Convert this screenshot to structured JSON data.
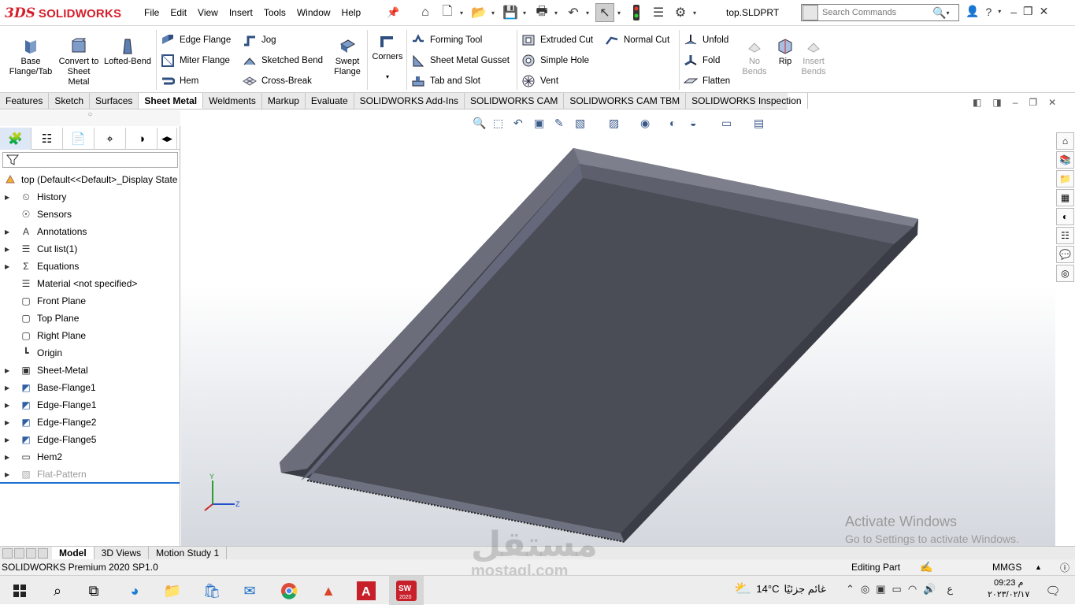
{
  "app": {
    "brand_prefix": "3DS",
    "brand": "SOLIDWORKS",
    "document_title": "top.SLDPRT"
  },
  "menu": [
    "File",
    "Edit",
    "View",
    "Insert",
    "Tools",
    "Window",
    "Help"
  ],
  "search": {
    "placeholder": "Search Commands"
  },
  "ribbon": {
    "base_flange": "Base Flange/Tab",
    "convert": "Convert to Sheet Metal",
    "lofted_bend": "Lofted-Bend",
    "edge_flange": "Edge Flange",
    "miter_flange": "Miter Flange",
    "hem": "Hem",
    "jog": "Jog",
    "sketched_bend": "Sketched Bend",
    "cross_break": "Cross-Break",
    "swept_flange": "Swept Flange",
    "corners": "Corners",
    "forming_tool": "Forming Tool",
    "sheet_metal_gusset": "Sheet Metal Gusset",
    "tab_and_slot": "Tab and Slot",
    "extruded_cut": "Extruded Cut",
    "simple_hole": "Simple Hole",
    "vent": "Vent",
    "normal_cut": "Normal Cut",
    "unfold": "Unfold",
    "fold": "Fold",
    "flatten": "Flatten",
    "no_bends": "No Bends",
    "rip": "Rip",
    "insert_bends": "Insert Bends"
  },
  "command_tabs": [
    "Features",
    "Sketch",
    "Surfaces",
    "Sheet Metal",
    "Weldments",
    "Markup",
    "Evaluate",
    "SOLIDWORKS Add-Ins",
    "SOLIDWORKS CAM",
    "SOLIDWORKS CAM TBM",
    "SOLIDWORKS Inspection"
  ],
  "active_command_tab": "Sheet Metal",
  "tree": {
    "root": "top  (Default<<Default>_Display State",
    "items": [
      "History",
      "Sensors",
      "Annotations",
      "Cut list(1)",
      "Equations",
      "Material <not specified>",
      "Front Plane",
      "Top Plane",
      "Right Plane",
      "Origin",
      "Sheet-Metal",
      "Base-Flange1",
      "Edge-Flange1",
      "Edge-Flange2",
      "Edge-Flange5",
      "Hem2",
      "Flat-Pattern"
    ]
  },
  "bottom_tabs": [
    "Model",
    "3D Views",
    "Motion Study 1"
  ],
  "status": {
    "product": "SOLIDWORKS Premium 2020 SP1.0",
    "mode": "Editing Part",
    "units": "MMGS"
  },
  "activate": {
    "line1": "Activate Windows",
    "line2": "Go to Settings to activate Windows."
  },
  "watermark": {
    "arabic": "مستقل",
    "latin": "mostaql.com"
  },
  "taskbar": {
    "weather": "14°C",
    "weather_text": "غائم جزئيًا",
    "lang": "ع",
    "time": "09:23 م",
    "date": "٢٠٢٣/٠٢/١٧",
    "sw_badge": "2020"
  },
  "colors": {
    "accent": "#1f6fd0",
    "brand_red": "#d51f2a",
    "part": "#4a4c56"
  }
}
